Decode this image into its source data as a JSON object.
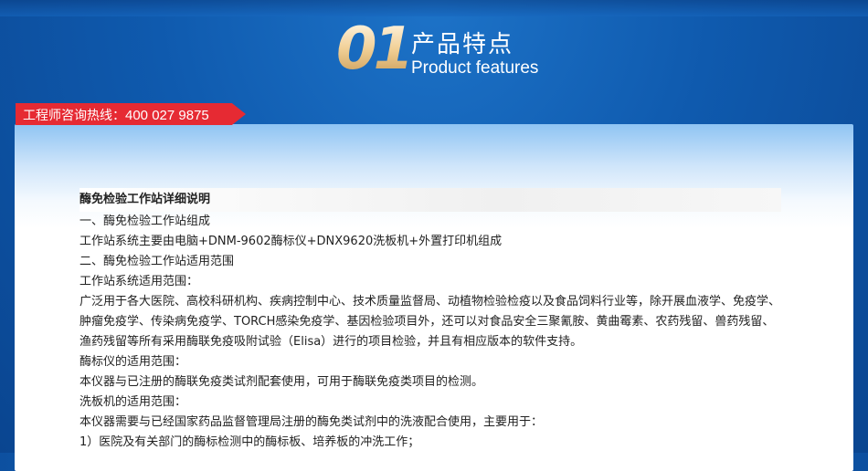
{
  "header": {
    "number": "01",
    "title_cn": "产品特点",
    "title_en": "Product features"
  },
  "hotline": {
    "label": "工程师咨询热线：",
    "phone": "400 027 9875"
  },
  "doc": {
    "title": "酶免检验工作站详细说明",
    "lines": [
      "一、酶免检验工作站组成",
      "工作站系统主要由电脑+DNM-9602酶标仪+DNX9620洗板机+外置打印机组成",
      "二、酶免检验工作站适用范围",
      "工作站系统适用范围：",
      "广泛用于各大医院、高校科研机构、疾病控制中心、技术质量监督局、动植物检验检疫以及食品饲料行业等，除开展血液学、免疫学、肿瘤免疫学、传染病免疫学、TORCH感染免疫学、基因检验项目外，还可以对食品安全三聚氰胺、黄曲霉素、农药残留、兽药残留、渔药残留等所有采用酶联免疫吸附试验（Elisa）进行的项目检验，并且有相应版本的软件支持。",
      "酶标仪的适用范围：",
      "本仪器与已注册的酶联免疫类试剂配套使用，可用于酶联免疫类项目的检测。",
      "洗板机的适用范围：",
      "本仪器需要与已经国家药品监督管理局注册的酶免类试剂中的洗液配合使用，主要用于：",
      "1）医院及有关部门的酶标检测中的酶标板、培养板的冲洗工作；"
    ]
  },
  "colors": {
    "background": "#0f5aae",
    "hotline_bg": "#e62a33",
    "number_gold": "#f1cf95"
  }
}
